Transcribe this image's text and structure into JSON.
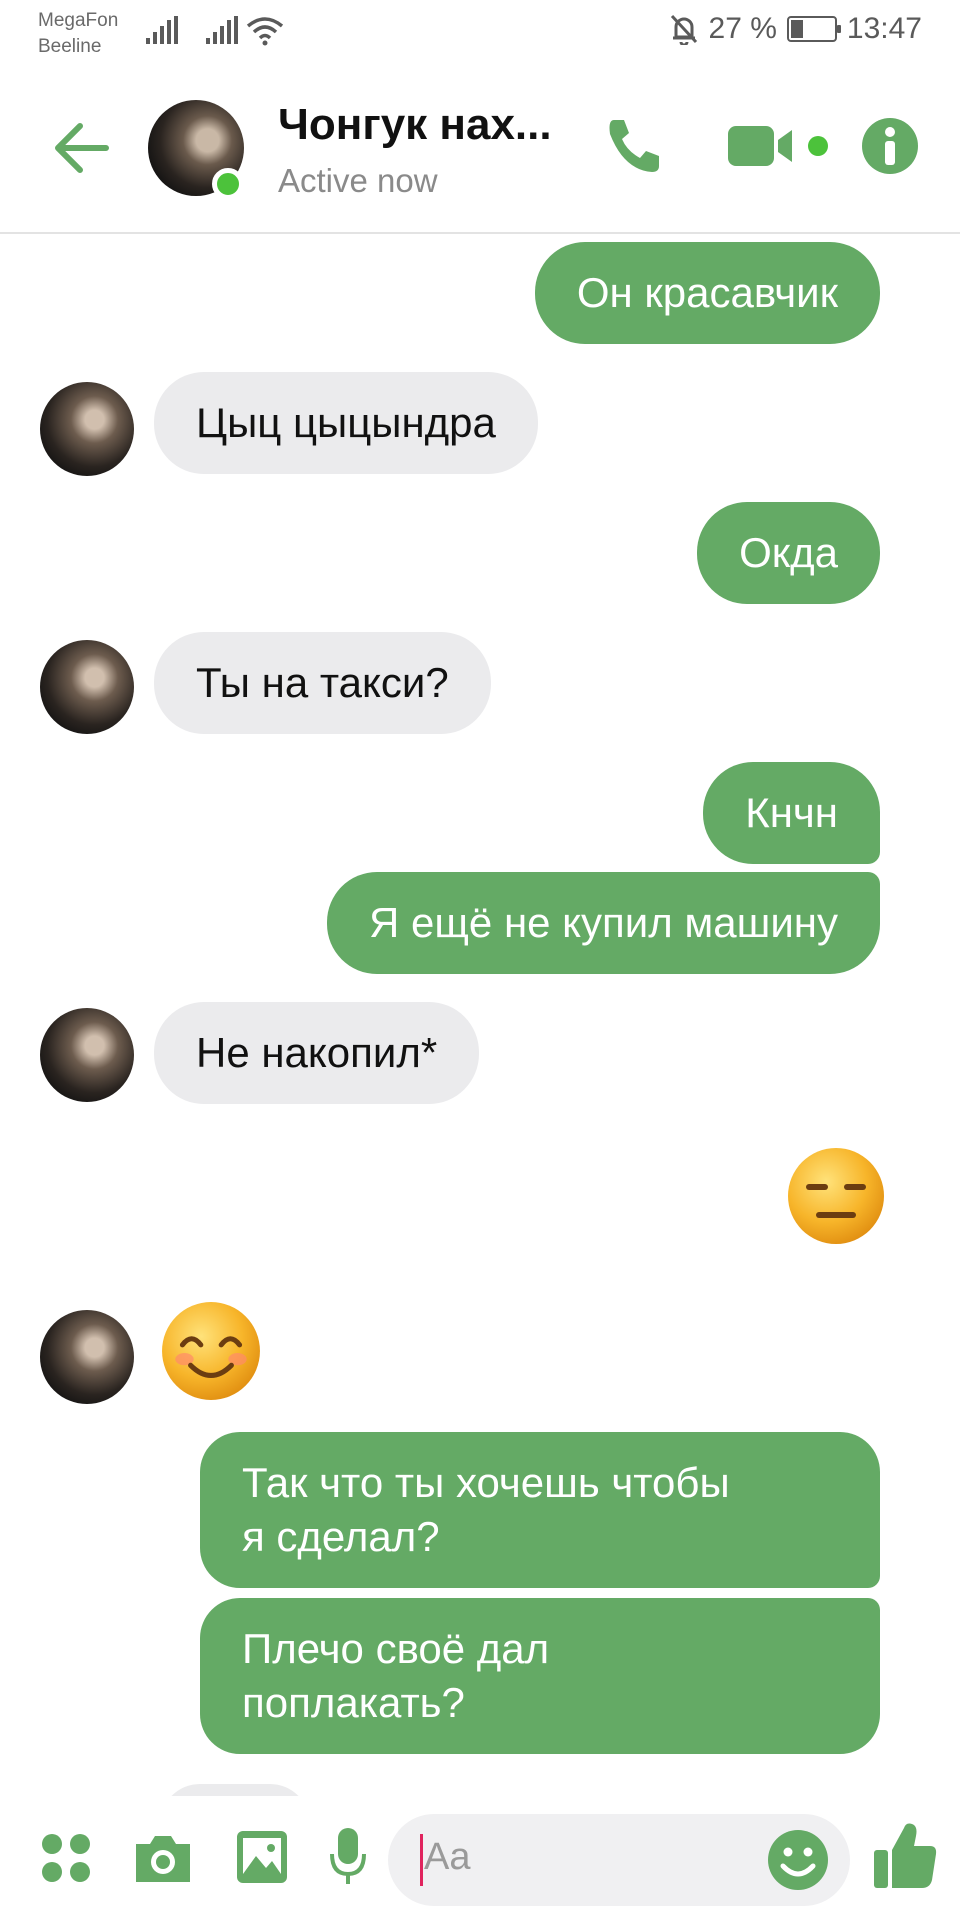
{
  "status_bar": {
    "carrier1": "MegaFon",
    "carrier2": "Beeline",
    "battery": "27 %",
    "battery_level": 0.27,
    "time": "13:47"
  },
  "header": {
    "contact_name": "Чонгук нах...",
    "status": "Active now",
    "icons": [
      "back-arrow-icon",
      "phone-icon",
      "video-camera-icon",
      "info-icon"
    ]
  },
  "messages": [
    {
      "side": "out",
      "text": "Он красавчик"
    },
    {
      "side": "in",
      "text": "Цыц цыцындра"
    },
    {
      "side": "out",
      "text": "Окда"
    },
    {
      "side": "in",
      "text": "Ты на такси?"
    },
    {
      "side": "out",
      "text": "Кнчн"
    },
    {
      "side": "out",
      "text": "Я ещё не купил машину"
    },
    {
      "side": "in",
      "text": "Не накопил*"
    },
    {
      "side": "out",
      "emoji": "expressionless-face-emoji"
    },
    {
      "side": "in",
      "emoji": "smiling-face-emoji"
    },
    {
      "side": "out",
      "text_lines": [
        "Так что ты хочешь чтобы",
        "я сделал?"
      ]
    },
    {
      "side": "out",
      "text_lines": [
        "Плечо своё дал",
        "поплакать?"
      ]
    }
  ],
  "composer": {
    "placeholder": "Aa",
    "icons": [
      "apps-icon",
      "camera-icon",
      "gallery-icon",
      "microphone-icon",
      "emoji-icon",
      "thumbs-up-icon"
    ]
  },
  "colors": {
    "accent": "#64aa65",
    "incoming_bubble": "#ebebed",
    "online": "#4cc23b"
  }
}
